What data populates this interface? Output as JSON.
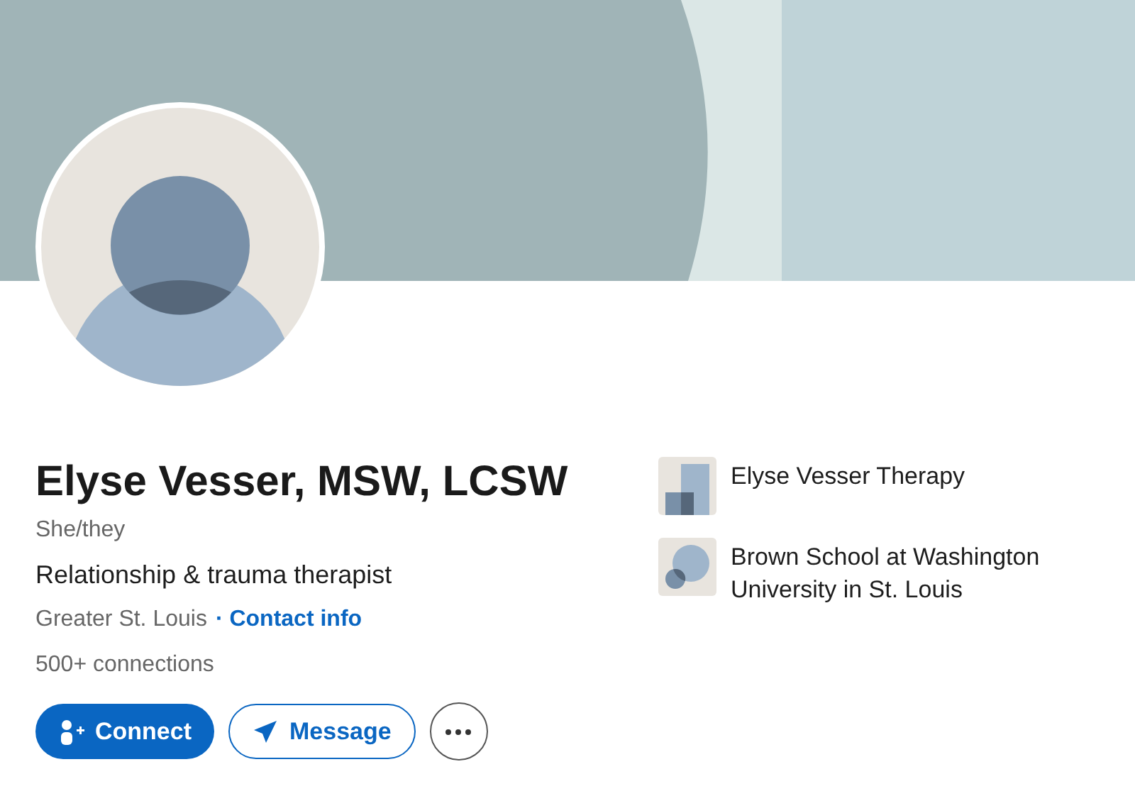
{
  "profile": {
    "name": "Elyse Vesser, MSW, LCSW",
    "pronouns": "She/they",
    "headline": "Relationship & trauma therapist",
    "location": "Greater St. Louis",
    "contact_link": "· Contact info",
    "connections": "500+ connections"
  },
  "actions": [
    {
      "kind": "primary",
      "label": "Connect"
    },
    {
      "kind": "outline",
      "label": "Message"
    },
    {
      "kind": "more"
    }
  ],
  "affiliations": [
    {
      "kind": "company",
      "name": "Elyse Vesser Therapy"
    },
    {
      "kind": "school",
      "name": "Brown School at Washington University in St. Louis"
    }
  ]
}
